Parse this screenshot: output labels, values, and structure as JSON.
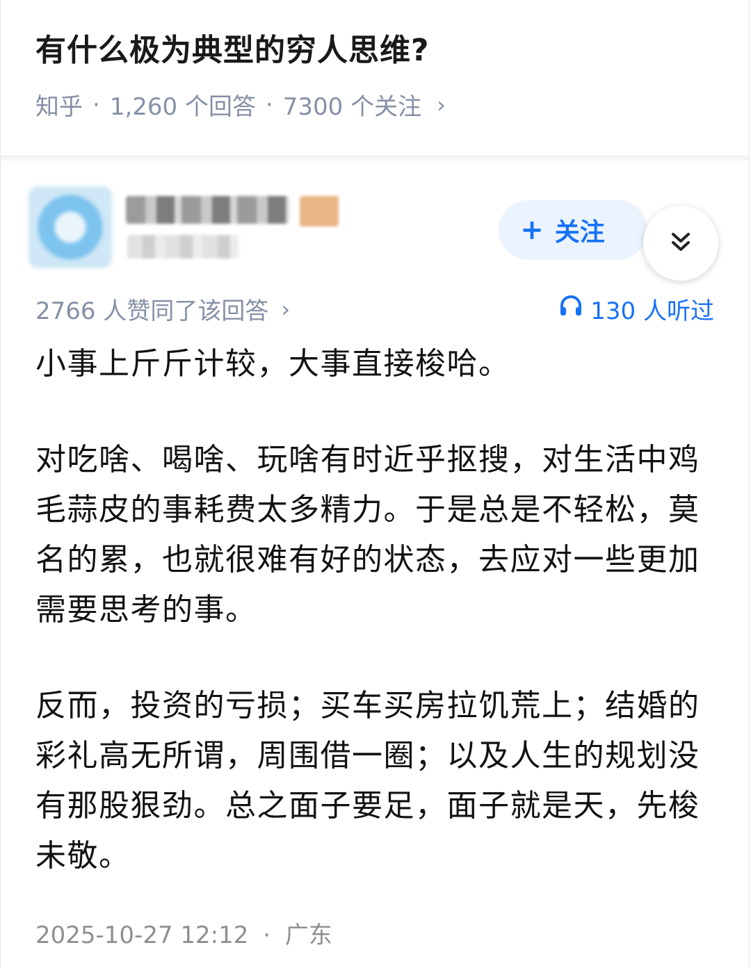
{
  "question": {
    "title": "有什么极为典型的穷人思维?",
    "source": "知乎",
    "answers": "1,260 个回答",
    "follows": "7300 个关注",
    "chevron": "›"
  },
  "author": {
    "follow_label": "关注",
    "follow_plus": "+"
  },
  "answer_meta": {
    "agree_text": "2766 人赞同了该回答",
    "chevron": "›",
    "listen_text": "130 人听过"
  },
  "answer": {
    "paragraphs": [
      "小事上斤斤计较，大事直接梭哈。",
      "对吃啥、喝啥、玩啥有时近乎抠搜，对生活中鸡毛蒜皮的事耗费太多精力。于是总是不轻松，莫名的累，也就很难有好的状态，去应对一些更加需要思考的事。",
      "反而，投资的亏损；买车买房拉饥荒上；结婚的彩礼高无所谓，周围借一圈；以及人生的规划没有那股狠劲。总之面子要足，面子就是天，先梭未敬。"
    ]
  },
  "footer": {
    "datetime": "2025-10-27 12:12",
    "dot": "·",
    "location": "广东"
  },
  "colors": {
    "accent": "#1772f6",
    "meta_gray": "#8590a6",
    "follow_bg": "#ebf3fe"
  },
  "icons": {
    "expand": "double-chevron-down-icon",
    "listen": "headphones-icon"
  }
}
